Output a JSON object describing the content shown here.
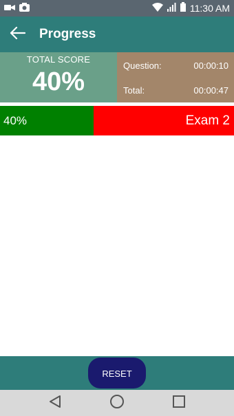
{
  "status_bar": {
    "time": "11:30 AM",
    "icons": [
      "video-camera-icon",
      "camera-icon",
      "wifi-icon",
      "signal-icon",
      "battery-icon"
    ]
  },
  "app_bar": {
    "title": "Progress",
    "back_icon": "arrow-left-icon"
  },
  "score": {
    "label": "TOTAL SCORE",
    "value": "40%"
  },
  "timing": {
    "question_label": "Question:",
    "question_time": "00:00:10",
    "total_label": "Total:",
    "total_time": "00:00:47"
  },
  "progress": {
    "percent_label": "40%",
    "exam_label": "Exam 2",
    "fraction": 0.4,
    "fill_color": "#008000",
    "rest_color": "#ff0000"
  },
  "bottom_bar": {
    "reset_label": "RESET"
  },
  "nav_bar": {
    "icons": [
      "back-triangle-icon",
      "home-circle-icon",
      "recents-square-icon"
    ]
  },
  "colors": {
    "app_bar": "#2e7d7a",
    "score_panel": "#6aa089",
    "time_panel": "#a3866a",
    "reset_button": "#1a1a6e"
  }
}
